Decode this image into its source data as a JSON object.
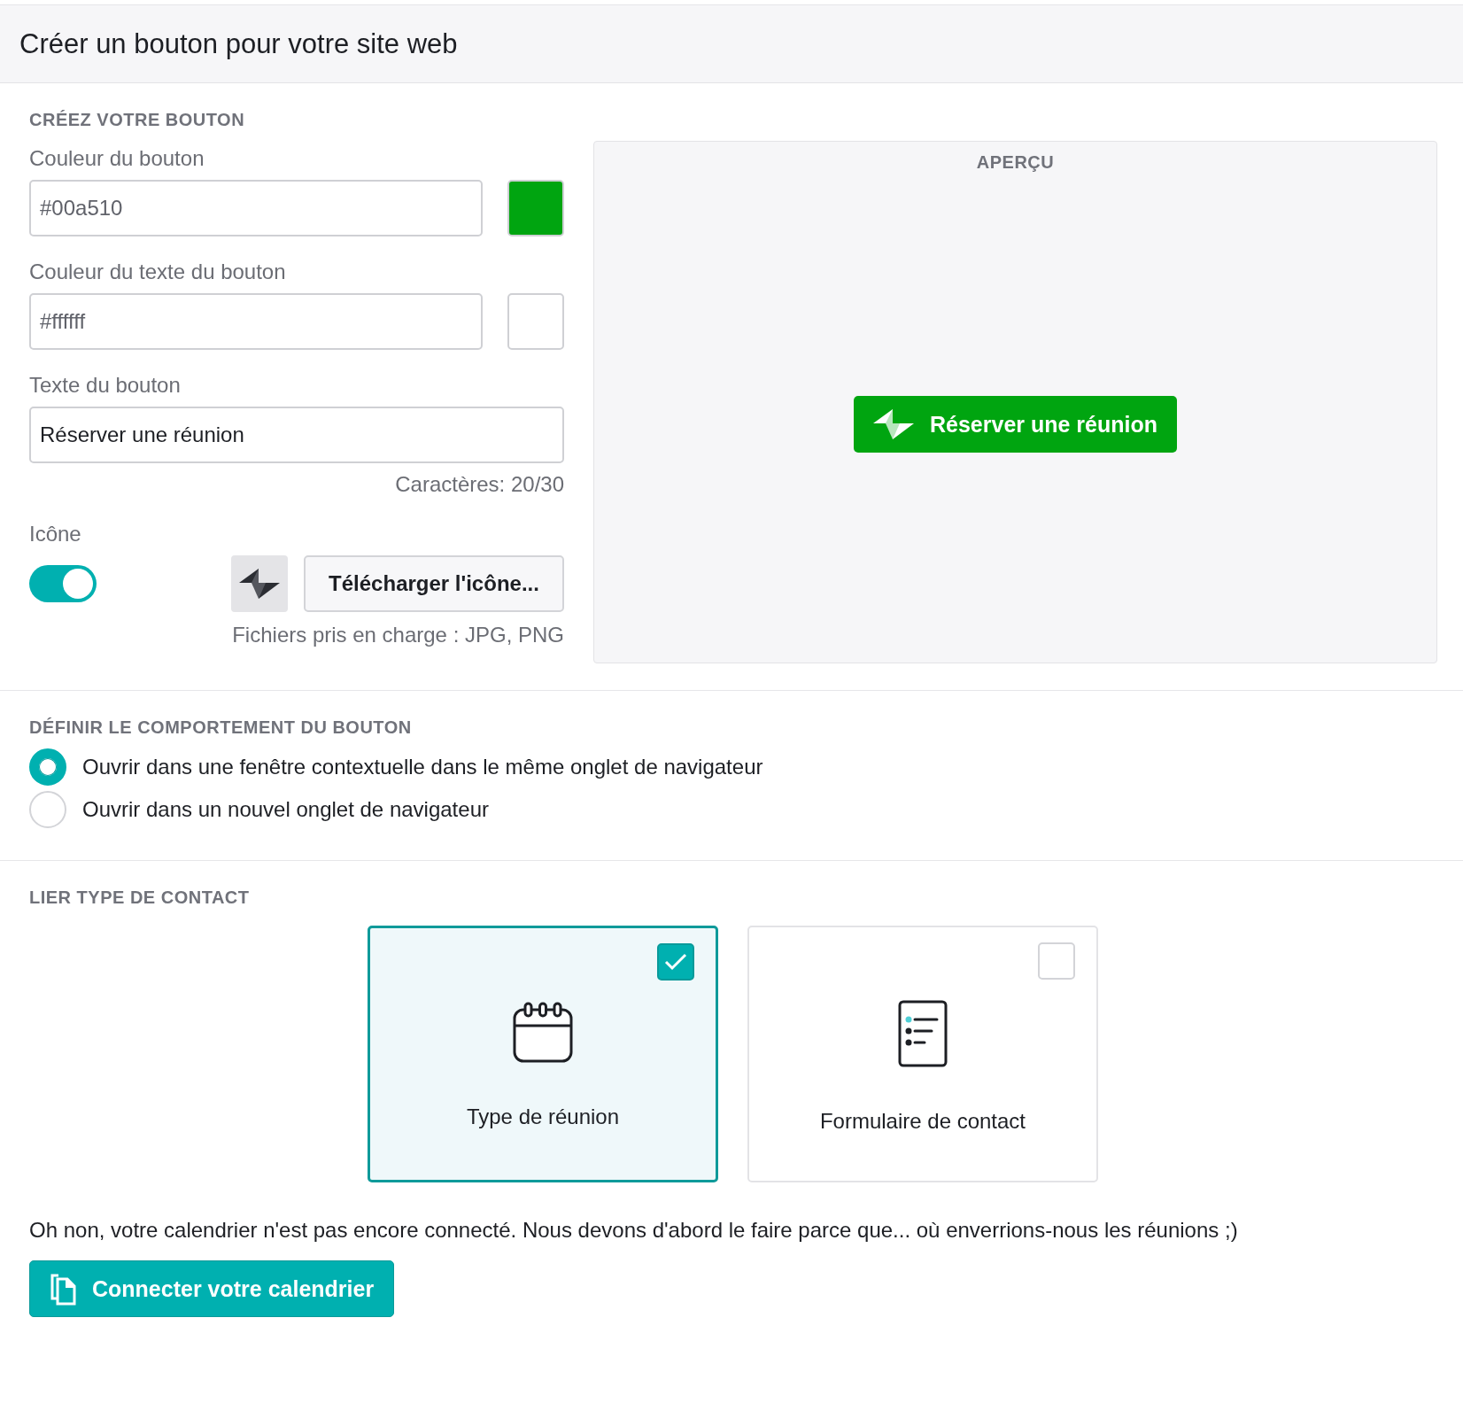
{
  "header": {
    "title": "Créer un bouton pour votre site web"
  },
  "design": {
    "heading": "CRÉEZ VOTRE BOUTON",
    "button_color": {
      "label": "Couleur du bouton",
      "value": "#00a510",
      "color": "#00a510"
    },
    "text_color": {
      "label": "Couleur du texte du bouton",
      "value": "#ffffff",
      "color": "#ffffff"
    },
    "button_text": {
      "label": "Texte du bouton",
      "value": "Réserver une réunion",
      "counter": "Caractères: 20/30"
    },
    "icon": {
      "label": "Icône",
      "on": true,
      "upload_button": "Télécharger l'icône...",
      "hint": "Fichiers pris en charge : JPG, PNG"
    }
  },
  "preview": {
    "heading": "APERÇU",
    "button_label": "Réserver une réunion"
  },
  "behaviour": {
    "heading": "DÉFINIR LE COMPORTEMENT DU BOUTON",
    "options": [
      {
        "label": "Ouvrir dans une fenêtre contextuelle dans le même onglet de navigateur",
        "selected": true
      },
      {
        "label": "Ouvrir dans un nouvel onglet de navigateur",
        "selected": false
      }
    ]
  },
  "contact_type": {
    "heading": "LIER TYPE DE CONTACT",
    "options": [
      {
        "kind": "calendar",
        "label": "Type de réunion",
        "selected": true
      },
      {
        "kind": "form",
        "label": "Formulaire de contact",
        "selected": false
      }
    ]
  },
  "notice": {
    "text": "Oh non, votre calendrier n'est pas encore connecté. Nous devons d'abord le faire parce que... où enverrions-nous les réunions ;)",
    "button": "Connecter votre calendrier"
  }
}
